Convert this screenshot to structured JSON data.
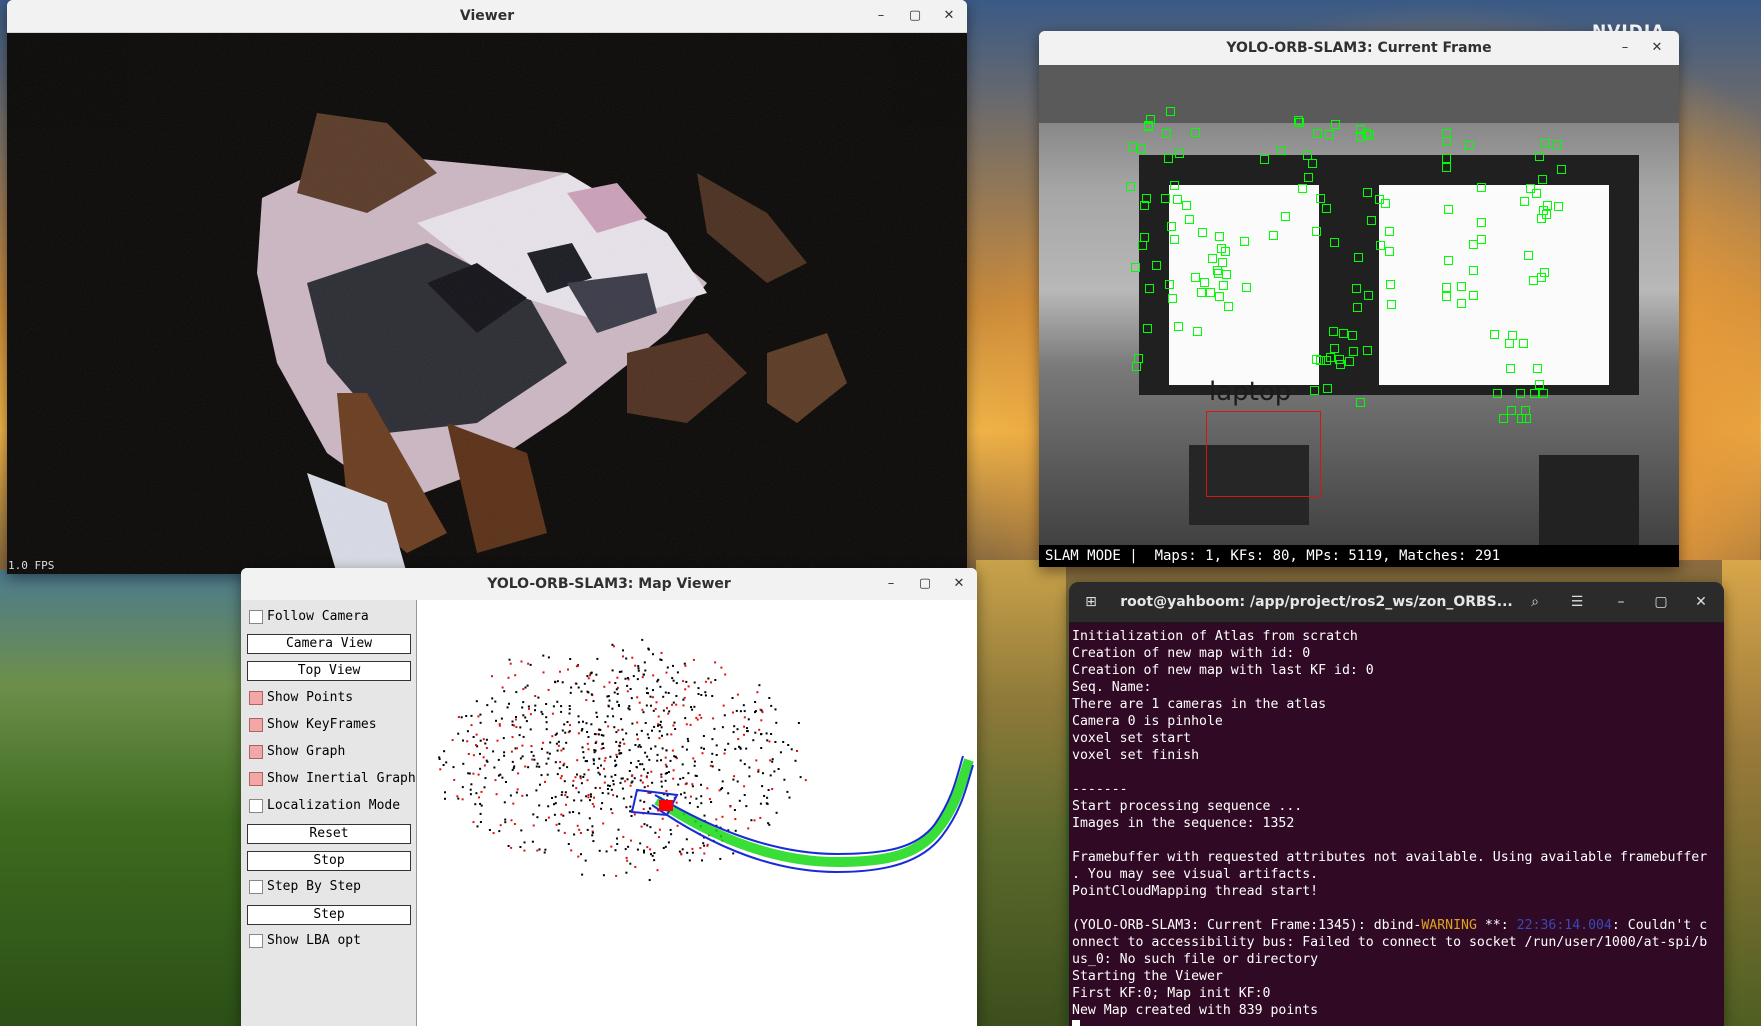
{
  "desktop": {
    "brand_text": "NVIDIA"
  },
  "viewer": {
    "title": "Viewer",
    "fps": "1.0 FPS",
    "controls": {
      "minimize": "–",
      "maximize": "▢",
      "close": "✕"
    }
  },
  "current_frame": {
    "title": "YOLO-ORB-SLAM3: Current Frame",
    "detection_label": "laptop",
    "status": "SLAM MODE |  Maps: 1, KFs: 80, MPs: 5119, Matches: 291",
    "controls": {
      "minimize": "–",
      "close": "✕"
    },
    "colors": {
      "keypoint": "#00ff00",
      "detection_box": "#d81515"
    }
  },
  "map_viewer": {
    "title": "YOLO-ORB-SLAM3: Map Viewer",
    "controls": {
      "minimize": "–",
      "maximize": "▢",
      "close": "✕"
    },
    "panel": {
      "follow_camera": {
        "label": "Follow Camera",
        "checked": false
      },
      "camera_view": "Camera View",
      "top_view": "Top View",
      "show_points": {
        "label": "Show Points",
        "checked": true
      },
      "show_keyframes": {
        "label": "Show KeyFrames",
        "checked": true
      },
      "show_graph": {
        "label": "Show Graph",
        "checked": true
      },
      "show_inertial_graph": {
        "label": "Show Inertial Graph",
        "checked": true
      },
      "localization_mode": {
        "label": "Localization Mode",
        "checked": false
      },
      "reset": "Reset",
      "stop": "Stop",
      "step_by_step": {
        "label": "Step By Step",
        "checked": false
      },
      "step": "Step",
      "show_lba_opt": {
        "label": "Show LBA opt",
        "checked": false
      }
    },
    "colors": {
      "map_points": "#000000",
      "reference_points": "#e01010",
      "keyframes": "#1a2ad8",
      "graph": "#16d816",
      "current_camera": "#ff0000"
    }
  },
  "terminal": {
    "title": "root@yahboom: /app/project/ros2_ws/zon_ORBS...",
    "controls": {
      "search": "⌕",
      "menu": "☰",
      "minimize": "–",
      "maximize": "▢",
      "close": "✕"
    },
    "lines": [
      "Initialization of Atlas from scratch",
      "Creation of new map with id: 0",
      "Creation of new map with last KF id: 0",
      "Seq. Name: ",
      "There are 1 cameras in the atlas",
      "Camera 0 is pinhole",
      "voxel set start",
      "voxel set finish",
      "",
      "-------",
      "Start processing sequence ...",
      "Images in the sequence: 1352",
      "",
      "Framebuffer with requested attributes not available. Using available framebuffer",
      ". You may see visual artifacts.",
      "PointCloudMapping thread start!",
      ""
    ],
    "warn_line": {
      "prefix": "(YOLO-ORB-SLAM3: Current Frame:1345): dbind-",
      "level": "WARNING",
      "mid": " **: ",
      "time": "22:36:14.004",
      "suffix": ": Couldn't c"
    },
    "lines_after": [
      "onnect to accessibility bus: Failed to connect to socket /run/user/1000/at-spi/b",
      "us_0: No such file or directory",
      "Starting the Viewer",
      "First KF:0; Map init KF:0",
      "New Map created with 839 points"
    ]
  }
}
